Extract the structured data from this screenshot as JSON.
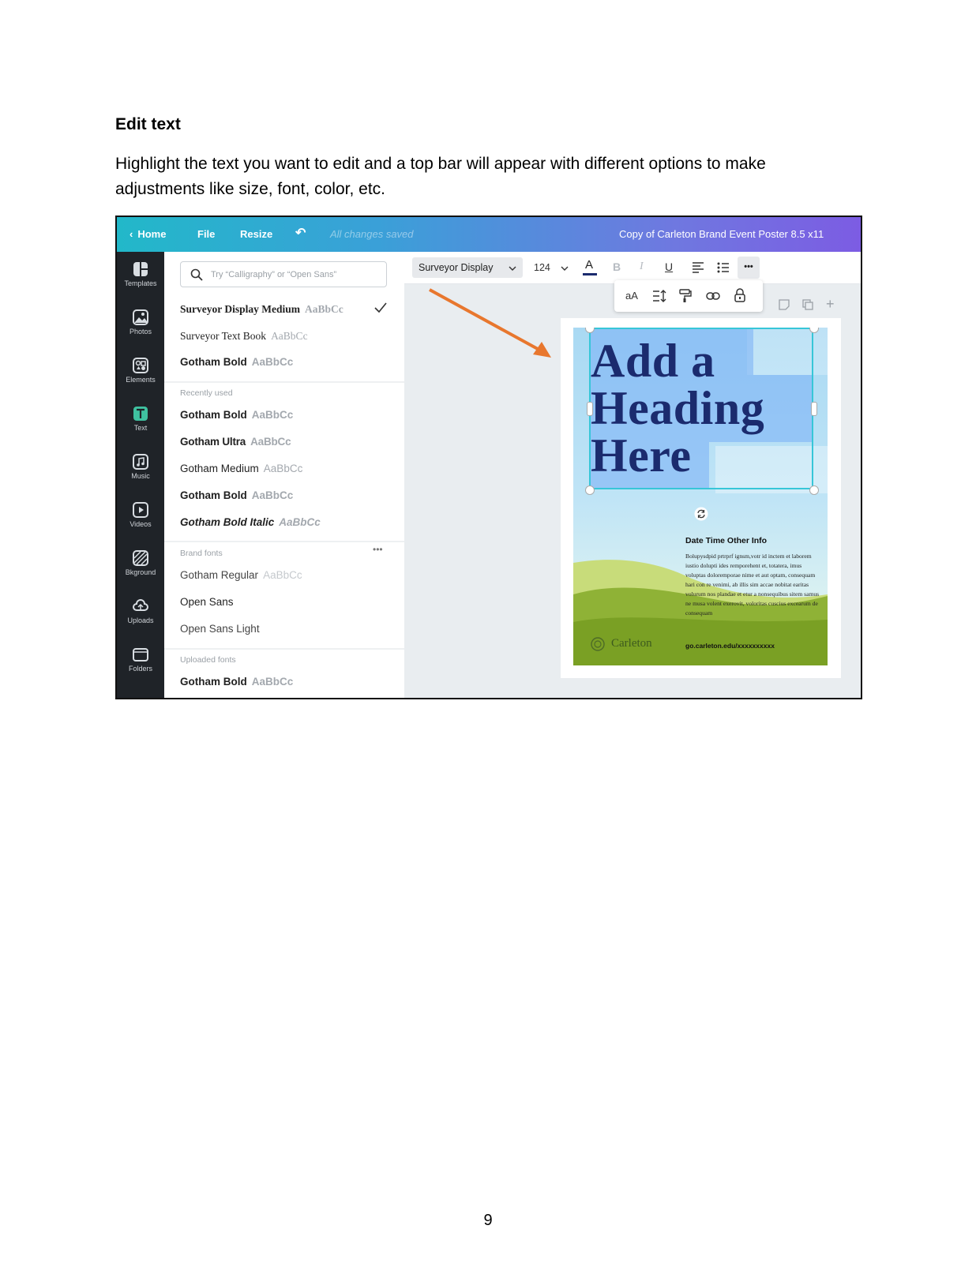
{
  "document": {
    "heading": "Edit text",
    "paragraph": "Highlight the text you want to edit and a top bar will appear with different options to make adjustments like size, font, color, etc.",
    "page_number": "9"
  },
  "screenshot": {
    "topbar": {
      "home": "Home",
      "file": "File",
      "resize": "Resize",
      "saved": "All changes saved",
      "doc_title": "Copy of Carleton Brand Event Poster 8.5 x11"
    },
    "sidenav": [
      {
        "label": "Templates",
        "icon": "templates-icon"
      },
      {
        "label": "Photos",
        "icon": "photos-icon"
      },
      {
        "label": "Elements",
        "icon": "elements-icon"
      },
      {
        "label": "Text",
        "icon": "text-icon"
      },
      {
        "label": "Music",
        "icon": "music-icon"
      },
      {
        "label": "Videos",
        "icon": "videos-icon"
      },
      {
        "label": "Bkground",
        "icon": "background-icon"
      },
      {
        "label": "Uploads",
        "icon": "uploads-icon"
      },
      {
        "label": "Folders",
        "icon": "folders-icon"
      }
    ],
    "font_panel": {
      "search_placeholder": "Try “Calligraphy” or “Open Sans”",
      "fonts_top": [
        {
          "name": "Surveyor Display Medium",
          "sample": "AaBbCc"
        },
        {
          "name": "Surveyor Text Book",
          "sample": "AaBbCc"
        },
        {
          "name": "Gotham Bold",
          "sample": "AaBbCc"
        }
      ],
      "recently_used_label": "Recently used",
      "recent": [
        {
          "name": "Gotham Bold",
          "sample": "AaBbCc"
        },
        {
          "name": "Gotham Ultra",
          "sample": "AaBbCc"
        },
        {
          "name": "Gotham Medium",
          "sample": "AaBbCc"
        },
        {
          "name": "Gotham Bold",
          "sample": "AaBbCc"
        },
        {
          "name": "Gotham Bold Italic",
          "sample": "AaBbCc"
        }
      ],
      "brand_fonts_label": "Brand fonts",
      "brand": [
        {
          "name": "Gotham Regular",
          "sample": "AaBbCc"
        },
        {
          "name": "Open Sans",
          "sample": ""
        },
        {
          "name": "Open Sans Light",
          "sample": ""
        }
      ],
      "uploaded_fonts_label": "Uploaded fonts",
      "uploaded": [
        {
          "name": "Gotham Bold",
          "sample": "AaBbCc"
        }
      ]
    },
    "toolbar": {
      "font": "Surveyor Display",
      "size": "124",
      "bold": "B",
      "italic": "I",
      "underline": "U",
      "more": "•••",
      "case": "aA"
    },
    "poster": {
      "heading_lines": [
        "Add a",
        "Heading",
        "Here"
      ],
      "date_line": "Date Time Other Info",
      "body": "Bolupysdpid prtrprf ignsm,votr id inctem et laborem iustio dolupti ides remporehent et, totatera, imus voluptas doloremporae nime et aut optam, consequam hari con re venimi, ab illis sim accae nobitat earitas volurum nos plandae et etur a nonsequibus sitem samus ne musa volent exerovit, voloritas cuscius excearum de consequam",
      "logo_text": "Carleton",
      "url": "go.carleton.edu/xxxxxxxxxx"
    },
    "colors": {
      "accent_arrow": "#e8772e",
      "heading_text": "#1b2b6e",
      "selection": "#37c6d8"
    }
  }
}
